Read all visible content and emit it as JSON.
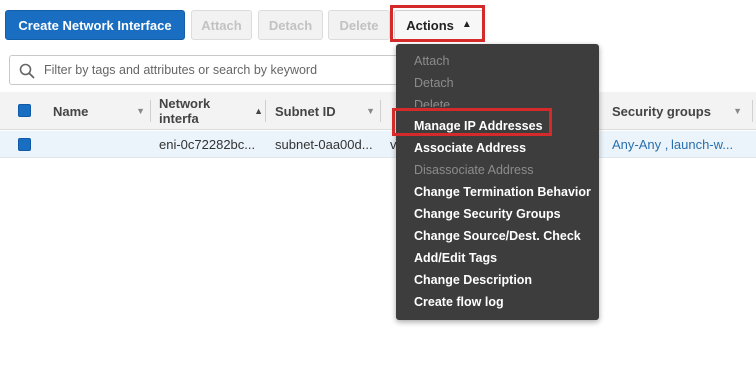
{
  "toolbar": {
    "create_label": "Create Network Interface",
    "attach_label": "Attach",
    "detach_label": "Detach",
    "delete_label": "Delete",
    "actions_label": "Actions"
  },
  "search": {
    "placeholder": "Filter by tags and attributes or search by keyword"
  },
  "table": {
    "columns": [
      {
        "label": "Name"
      },
      {
        "label": "Network interfa"
      },
      {
        "label": "Subnet ID"
      },
      {
        "label": "Security groups"
      }
    ],
    "rows": [
      {
        "network_interface": "eni-0c72282bc...",
        "subnet_id": "subnet-0aa00d...",
        "vpc_fragment": "v",
        "sg_1": "Any-Any ,",
        "sg_2": "launch-w..."
      }
    ]
  },
  "actions_menu": {
    "items": [
      {
        "label": "Attach",
        "enabled": false
      },
      {
        "label": "Detach",
        "enabled": false
      },
      {
        "label": "Delete",
        "enabled": false
      },
      {
        "label": "Manage IP Addresses",
        "enabled": true
      },
      {
        "label": "Associate Address",
        "enabled": true
      },
      {
        "label": "Disassociate Address",
        "enabled": false
      },
      {
        "label": "Change Termination Behavior",
        "enabled": true
      },
      {
        "label": "Change Security Groups",
        "enabled": true
      },
      {
        "label": "Change Source/Dest. Check",
        "enabled": true
      },
      {
        "label": "Add/Edit Tags",
        "enabled": true
      },
      {
        "label": "Change Description",
        "enabled": true
      },
      {
        "label": "Create flow log",
        "enabled": true
      }
    ]
  },
  "colors": {
    "primary": "#1a6ec1",
    "highlight": "#d42a2a",
    "menu_bg": "#3d3d3d",
    "selected_row": "#ebf4fb"
  }
}
